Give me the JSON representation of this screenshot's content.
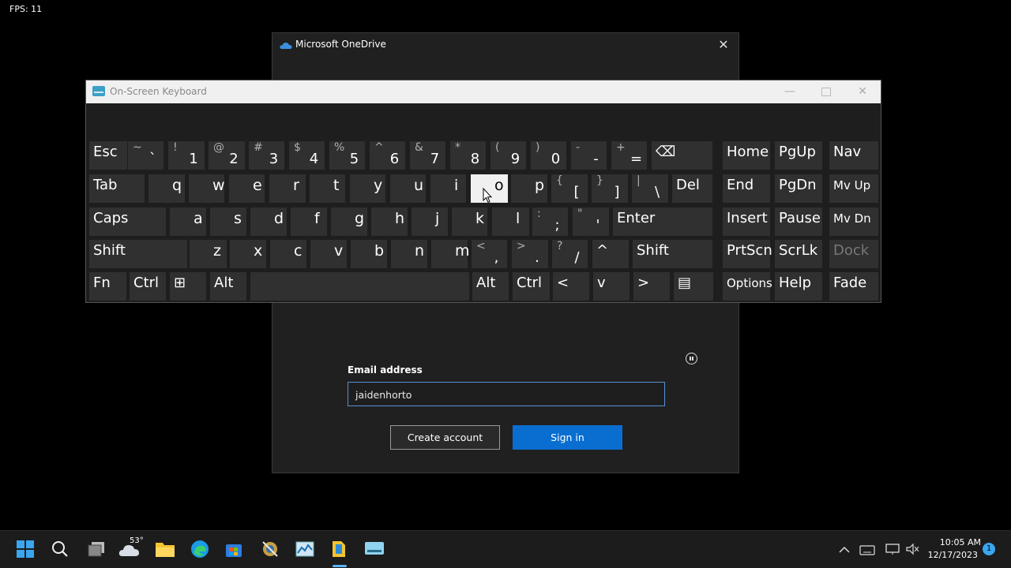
{
  "fps": "FPS: 11",
  "onedrive": {
    "title": "Microsoft OneDrive",
    "email_label": "Email address",
    "email_value": "jaidenhorto",
    "create_label": "Create account",
    "signin_label": "Sign in",
    "close_glyph": "✕"
  },
  "osk": {
    "title": "On-Screen Keyboard",
    "min_glyph": "—",
    "close_glyph": "✕",
    "rows": {
      "r1": [
        {
          "t": "Esc"
        },
        {
          "s": "~",
          "b": "`"
        },
        {
          "s": "!",
          "b": "1"
        },
        {
          "s": "@",
          "b": "2"
        },
        {
          "s": "#",
          "b": "3"
        },
        {
          "s": "$",
          "b": "4"
        },
        {
          "s": "%",
          "b": "5"
        },
        {
          "s": "^",
          "b": "6"
        },
        {
          "s": "&",
          "b": "7"
        },
        {
          "s": "*",
          "b": "8"
        },
        {
          "s": "(",
          "b": "9"
        },
        {
          "s": ")",
          "b": "0"
        },
        {
          "s": "-",
          "b": "-"
        },
        {
          "s": "+",
          "b": "="
        },
        {
          "t": "⌫"
        },
        {
          "t": "Home"
        },
        {
          "t": "PgUp"
        },
        {
          "t": "Nav"
        }
      ],
      "r2": [
        {
          "t": "Tab"
        },
        {
          "t": "q"
        },
        {
          "t": "w"
        },
        {
          "t": "e"
        },
        {
          "t": "r"
        },
        {
          "t": "t"
        },
        {
          "t": "y"
        },
        {
          "t": "u"
        },
        {
          "t": "i"
        },
        {
          "t": "o"
        },
        {
          "t": "p"
        },
        {
          "s": "{",
          "b": "["
        },
        {
          "s": "}",
          "b": "]"
        },
        {
          "s": "|",
          "b": "\\"
        },
        {
          "t": "Del"
        },
        {
          "t": "End"
        },
        {
          "t": "PgDn"
        },
        {
          "t": "Mv Up"
        }
      ],
      "r3": [
        {
          "t": "Caps"
        },
        {
          "t": "a"
        },
        {
          "t": "s"
        },
        {
          "t": "d"
        },
        {
          "t": "f"
        },
        {
          "t": "g"
        },
        {
          "t": "h"
        },
        {
          "t": "j"
        },
        {
          "t": "k"
        },
        {
          "t": "l"
        },
        {
          "s": ":",
          "b": ";"
        },
        {
          "s": "\"",
          "b": "'"
        },
        {
          "t": "Enter"
        },
        {
          "t": "Insert"
        },
        {
          "t": "Pause"
        },
        {
          "t": "Mv Dn"
        }
      ],
      "r4": [
        {
          "t": "Shift"
        },
        {
          "t": "z"
        },
        {
          "t": "x"
        },
        {
          "t": "c"
        },
        {
          "t": "v"
        },
        {
          "t": "b"
        },
        {
          "t": "n"
        },
        {
          "t": "m"
        },
        {
          "s": "<",
          "b": ","
        },
        {
          "s": ">",
          "b": "."
        },
        {
          "s": "?",
          "b": "/"
        },
        {
          "t": "^"
        },
        {
          "t": "Shift"
        },
        {
          "t": "PrtScn"
        },
        {
          "t": "ScrLk"
        },
        {
          "t": "Dock"
        }
      ],
      "r5": [
        {
          "t": "Fn"
        },
        {
          "t": "Ctrl"
        },
        {
          "t": "⊞"
        },
        {
          "t": "Alt"
        },
        {
          "t": ""
        },
        {
          "t": "Alt"
        },
        {
          "t": "Ctrl"
        },
        {
          "t": "<"
        },
        {
          "t": "v"
        },
        {
          "t": ">"
        },
        {
          "t": "▤"
        },
        {
          "t": "Options"
        },
        {
          "t": "Help"
        },
        {
          "t": "Fade"
        }
      ]
    }
  },
  "taskbar": {
    "weather_temp": "53°",
    "time": "10:05 AM",
    "date": "12/17/2023",
    "notification_count": "1"
  }
}
